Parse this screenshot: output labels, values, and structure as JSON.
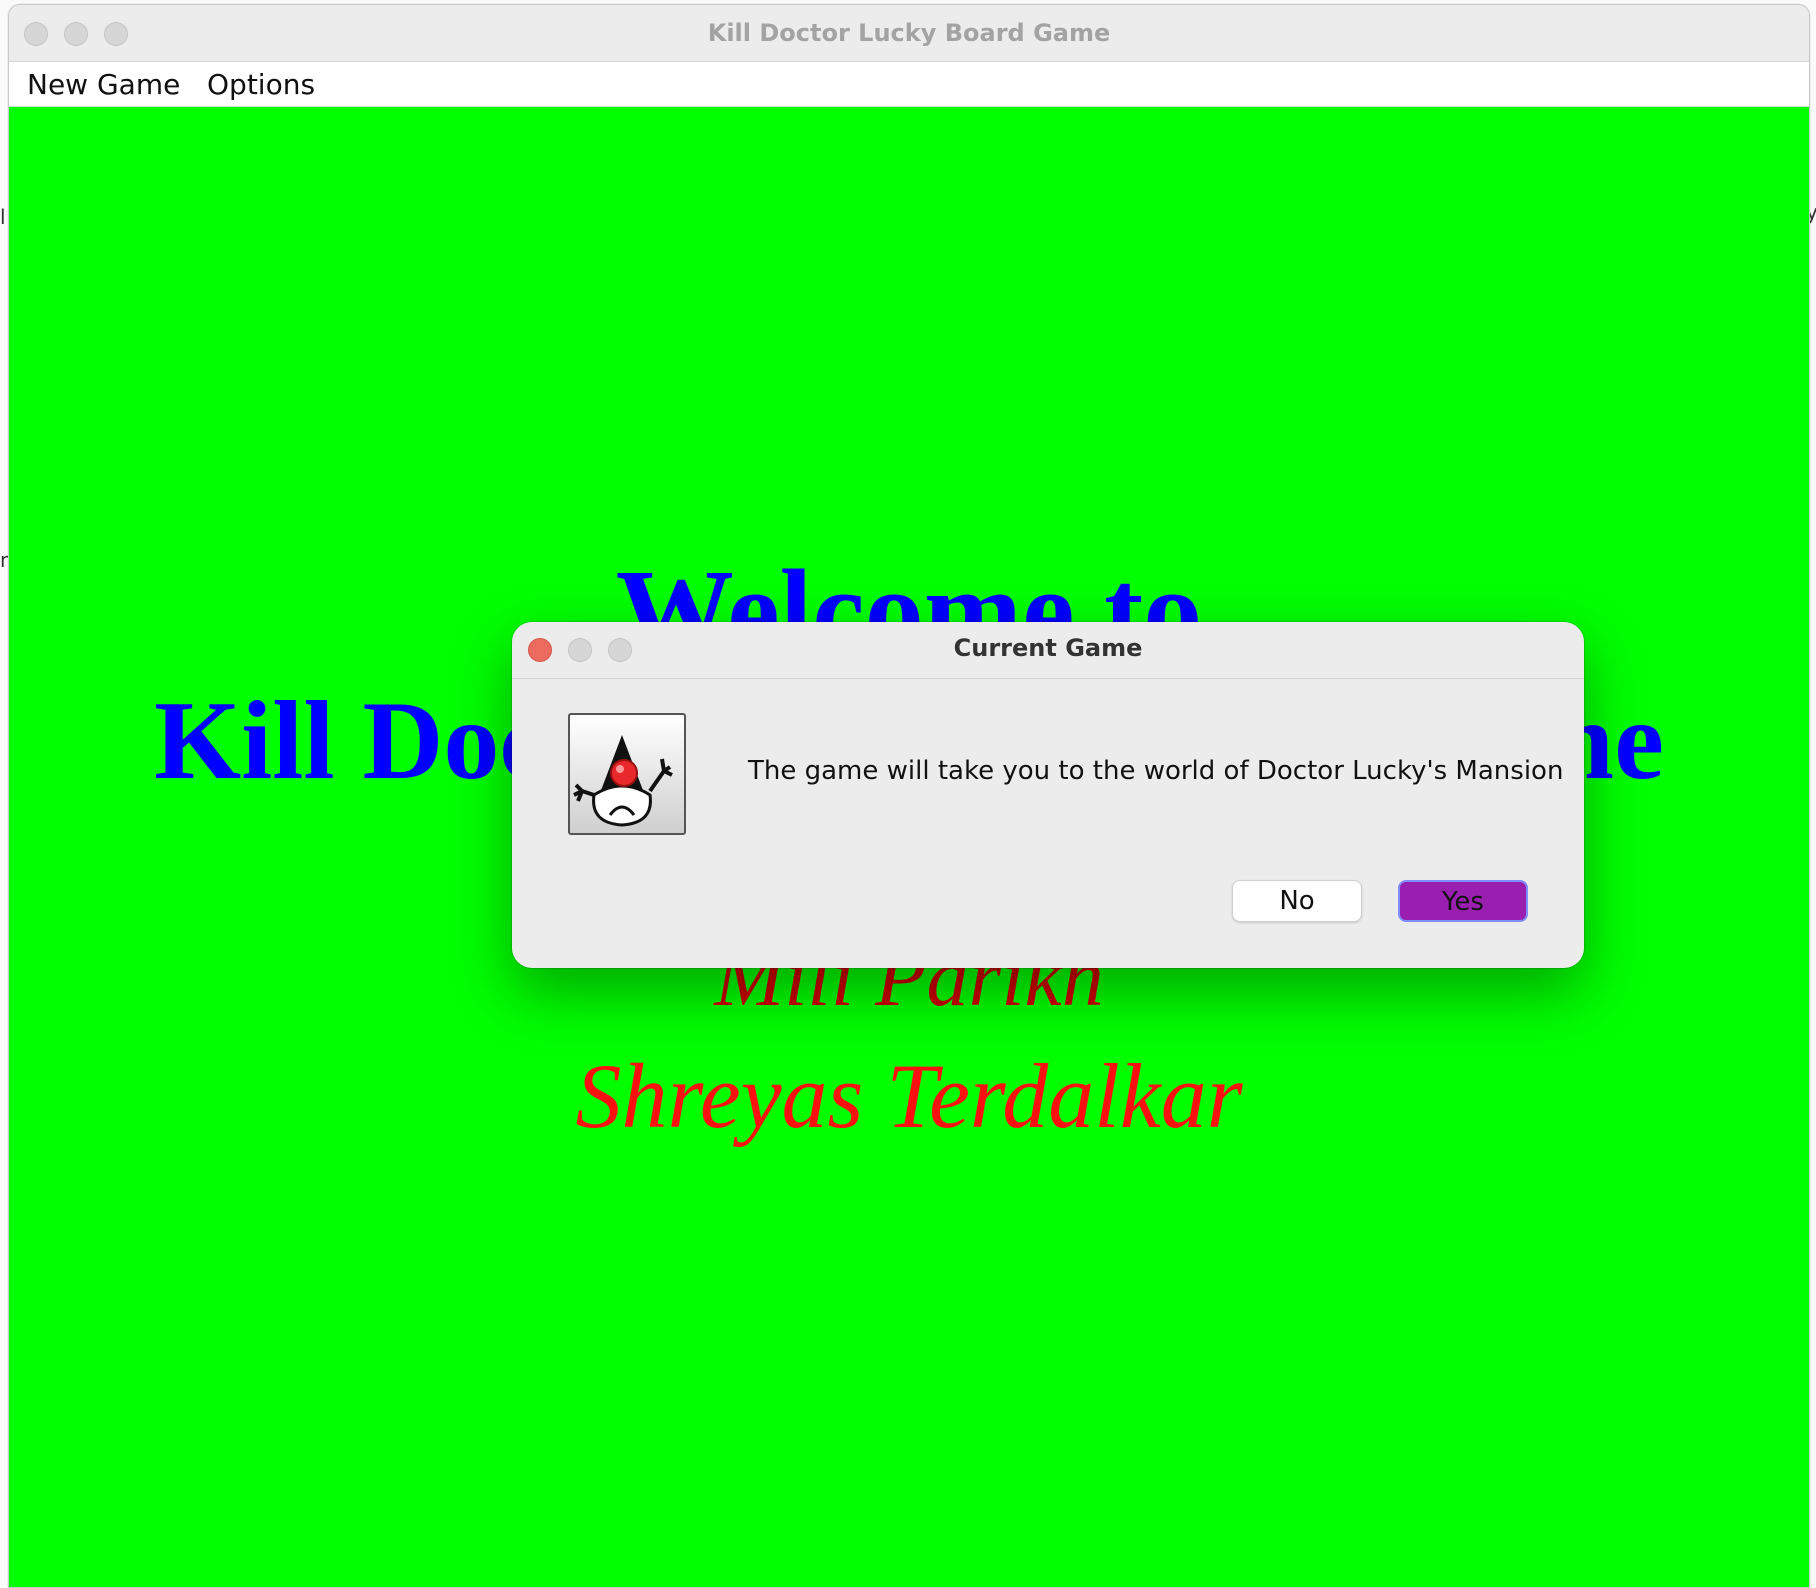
{
  "window": {
    "title": "Kill Doctor Lucky Board Game"
  },
  "menubar": {
    "items": [
      "New Game",
      "Options"
    ]
  },
  "welcome": {
    "line1": "Welcome to",
    "line2": "Kill Doctor Lucky Board Game",
    "authors": [
      "Mili Parikh",
      "Shreyas Terdalkar"
    ]
  },
  "dialog": {
    "title": "Current Game",
    "message": "The game will take you to the world of Doctor Lucky's Mansion",
    "icon": "java-duke-icon",
    "buttons": {
      "no": "No",
      "yes": "Yes"
    }
  },
  "colors": {
    "background": "#00ff00",
    "welcome_text": "#0000ff",
    "author_text": "#cc0000",
    "yes_button": "#9a1fb0"
  }
}
